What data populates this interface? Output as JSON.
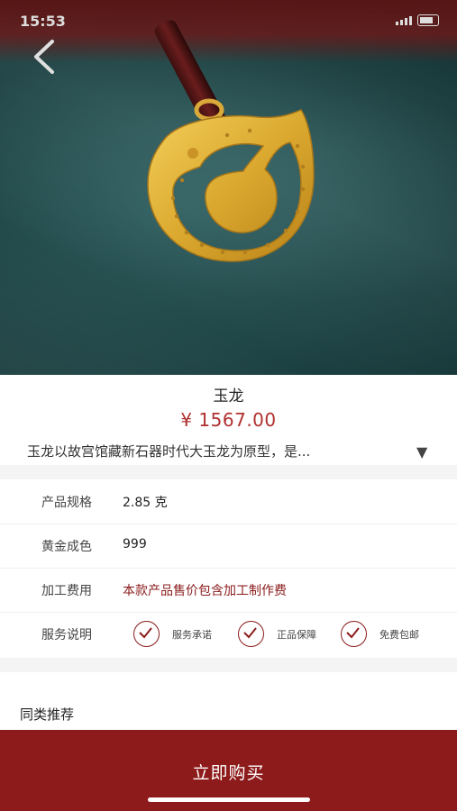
{
  "status": {
    "time": "15:53"
  },
  "product": {
    "title": "玉龙",
    "price": "¥ 1567.00",
    "description": "玉龙以故宫馆藏新石器时代大玉龙为原型，是..."
  },
  "specs": [
    {
      "label": "产品规格",
      "value": "2.85 克"
    },
    {
      "label": "黄金成色",
      "value": "999"
    },
    {
      "label": "加工费用",
      "value": "本款产品售价包含加工制作费"
    }
  ],
  "service": {
    "label": "服务说明",
    "items": [
      "服务承诺",
      "正品保障",
      "免费包邮"
    ]
  },
  "recommend": {
    "heading": "同类推荐"
  },
  "buy": {
    "label": "立即购买"
  },
  "colors": {
    "accent": "#8e1b1b",
    "price": "#b03030",
    "gold": "#e0b23a"
  },
  "icons": {
    "back": "chevron-left-icon",
    "expand": "triangle-down-icon",
    "check": "check-circle-icon"
  }
}
